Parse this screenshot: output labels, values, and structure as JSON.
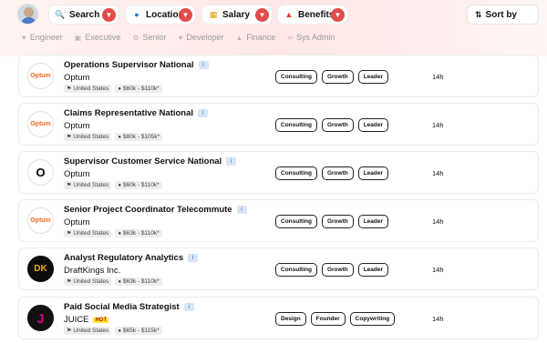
{
  "filters": [
    {
      "label": "Search",
      "icon": "search-icon"
    },
    {
      "label": "Location",
      "icon": "globe-icon"
    },
    {
      "label": "Salary",
      "icon": "money-icon"
    },
    {
      "label": "Benefits",
      "icon": "benefits-icon"
    }
  ],
  "sort": {
    "label": "Sort by",
    "icon": "sort-icon"
  },
  "categories": [
    {
      "label": "Engineer",
      "icon": "heart-icon"
    },
    {
      "label": "Executive",
      "icon": "building-icon"
    },
    {
      "label": "Senior",
      "icon": "gear-icon"
    },
    {
      "label": "Developer",
      "icon": "heart-icon"
    },
    {
      "label": "Finance",
      "icon": "bank-icon"
    },
    {
      "label": "Sys Admin",
      "icon": "infinity-icon"
    }
  ],
  "jobs": [
    {
      "title": "Operations Supervisor National",
      "company": "Optum",
      "logo": "Optum",
      "location": "United States",
      "salary": "$60k - $110k*",
      "skills": [
        "Consulting",
        "Growth",
        "Leader"
      ],
      "age": "14h"
    },
    {
      "title": "Claims Representative National",
      "company": "Optum",
      "logo": "Optum",
      "location": "United States",
      "salary": "$80k - $105k*",
      "skills": [
        "Consulting",
        "Growth",
        "Leader"
      ],
      "age": "14h"
    },
    {
      "title": "Supervisor Customer Service National",
      "company": "Optum",
      "logo": "O",
      "location": "United States",
      "salary": "$60k - $110k*",
      "skills": [
        "Consulting",
        "Growth",
        "Leader"
      ],
      "age": "14h"
    },
    {
      "title": "Senior Project Coordinator Telecommute",
      "company": "Optum",
      "logo": "Optum",
      "location": "United States",
      "salary": "$63k - $110k*",
      "skills": [
        "Consulting",
        "Growth",
        "Leader"
      ],
      "age": "14h"
    },
    {
      "title": "Analyst Regulatory Analytics",
      "company": "DraftKings Inc.",
      "logo": "DK",
      "location": "United States",
      "salary": "$63k - $110k*",
      "skills": [
        "Consulting",
        "Growth",
        "Leader"
      ],
      "age": "14h"
    },
    {
      "title": "Paid Social Media Strategist",
      "company": "JUICE",
      "badge": "HOT",
      "logo": "J",
      "location": "United States",
      "salary": "$65k - $115k*",
      "skills": [
        "Design",
        "Founder",
        "Copywriting"
      ],
      "age": "14h"
    }
  ],
  "colors": {
    "accent": "#e34b4b",
    "optum": "#f26b21",
    "juice": "#e4007e"
  }
}
